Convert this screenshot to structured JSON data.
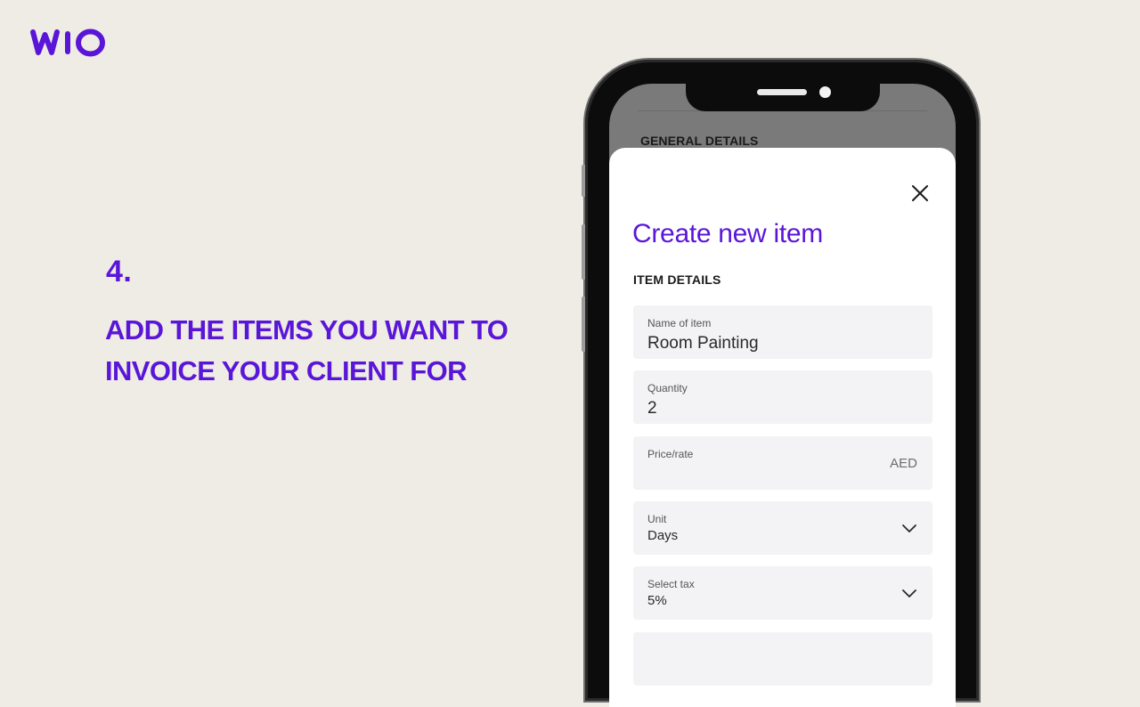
{
  "brand": {
    "logo_text": "WIO",
    "accent_color": "#5a16d8"
  },
  "instruction": {
    "step_number": "4.",
    "line1": "ADD THE ITEMS YOU WANT TO",
    "line2": "INVOICE YOUR CLIENT FOR"
  },
  "screen": {
    "background_section": "GENERAL DETAILS",
    "sheet": {
      "close_icon": "close-icon",
      "title": "Create new item",
      "section_label": "ITEM DETAILS",
      "fields": {
        "name": {
          "label": "Name of item",
          "value": "Room Painting"
        },
        "quantity": {
          "label": "Quantity",
          "value": "2"
        },
        "price": {
          "label": "Price/rate",
          "value": "",
          "suffix": "AED"
        },
        "unit": {
          "label": "Unit",
          "value": "Days",
          "icon": "chevron-down-icon"
        },
        "tax": {
          "label": "Select tax",
          "value": "5%",
          "icon": "chevron-down-icon"
        }
      }
    }
  }
}
